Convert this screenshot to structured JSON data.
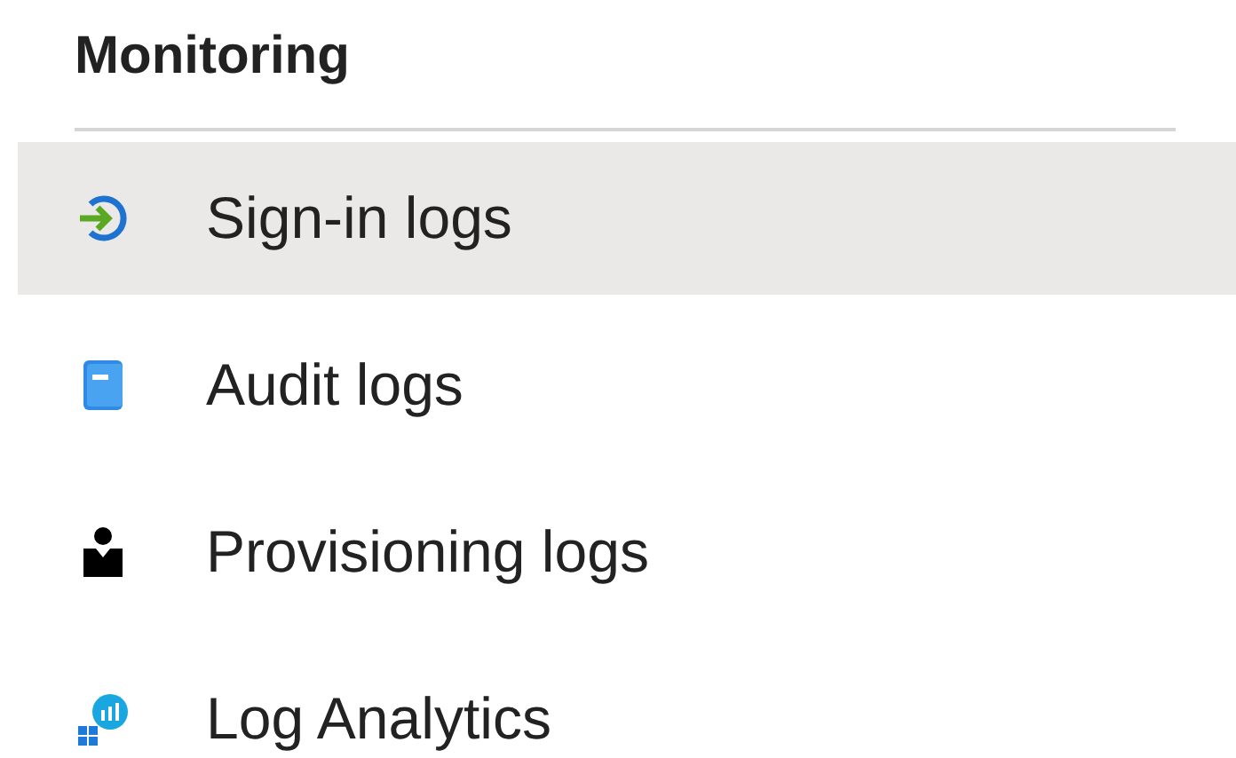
{
  "section": {
    "title": "Monitoring"
  },
  "items": [
    {
      "label": "Sign-in logs",
      "kind": "signin",
      "selected": true
    },
    {
      "label": "Audit logs",
      "kind": "book",
      "selected": false
    },
    {
      "label": "Provisioning logs",
      "kind": "person",
      "selected": false
    },
    {
      "label": "Log Analytics",
      "kind": "analytics",
      "selected": false
    }
  ]
}
